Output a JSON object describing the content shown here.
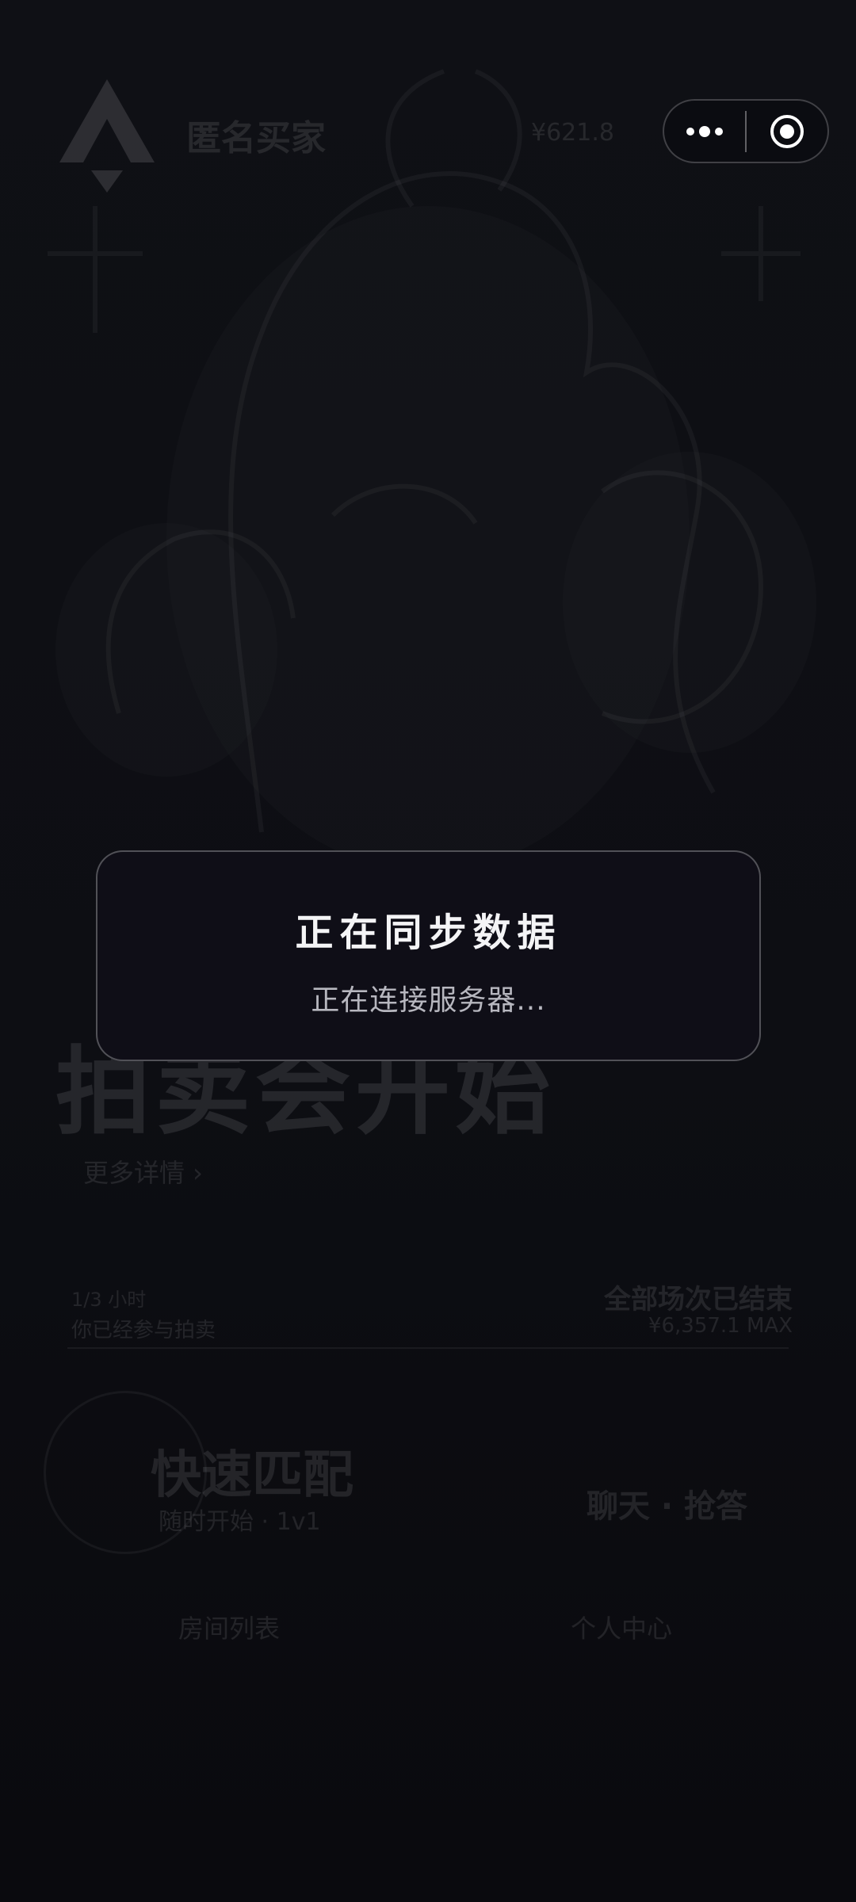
{
  "background": {
    "brand_name": "匿名买家",
    "header_count": "¥621.8",
    "hero_title": "拍卖会开始",
    "details_link": "更多详情 ›",
    "stats": {
      "left_line1": "1/3 小时",
      "left_line2": "你已经参与拍卖",
      "right_line1": "全部场次已结束",
      "right_line2": "¥6,357.1 MAX"
    },
    "quick_match": "快速匹配",
    "quick_match_sub": "随时开始 · 1v1",
    "chat_label": "聊天 · 抢答",
    "bottom_left": "房间列表",
    "bottom_right": "个人中心"
  },
  "capsule": {
    "more_icon": "more-dots-icon",
    "close_icon": "target-circle-icon"
  },
  "modal": {
    "title": "正在同步数据",
    "message": "正在连接服务器..."
  }
}
